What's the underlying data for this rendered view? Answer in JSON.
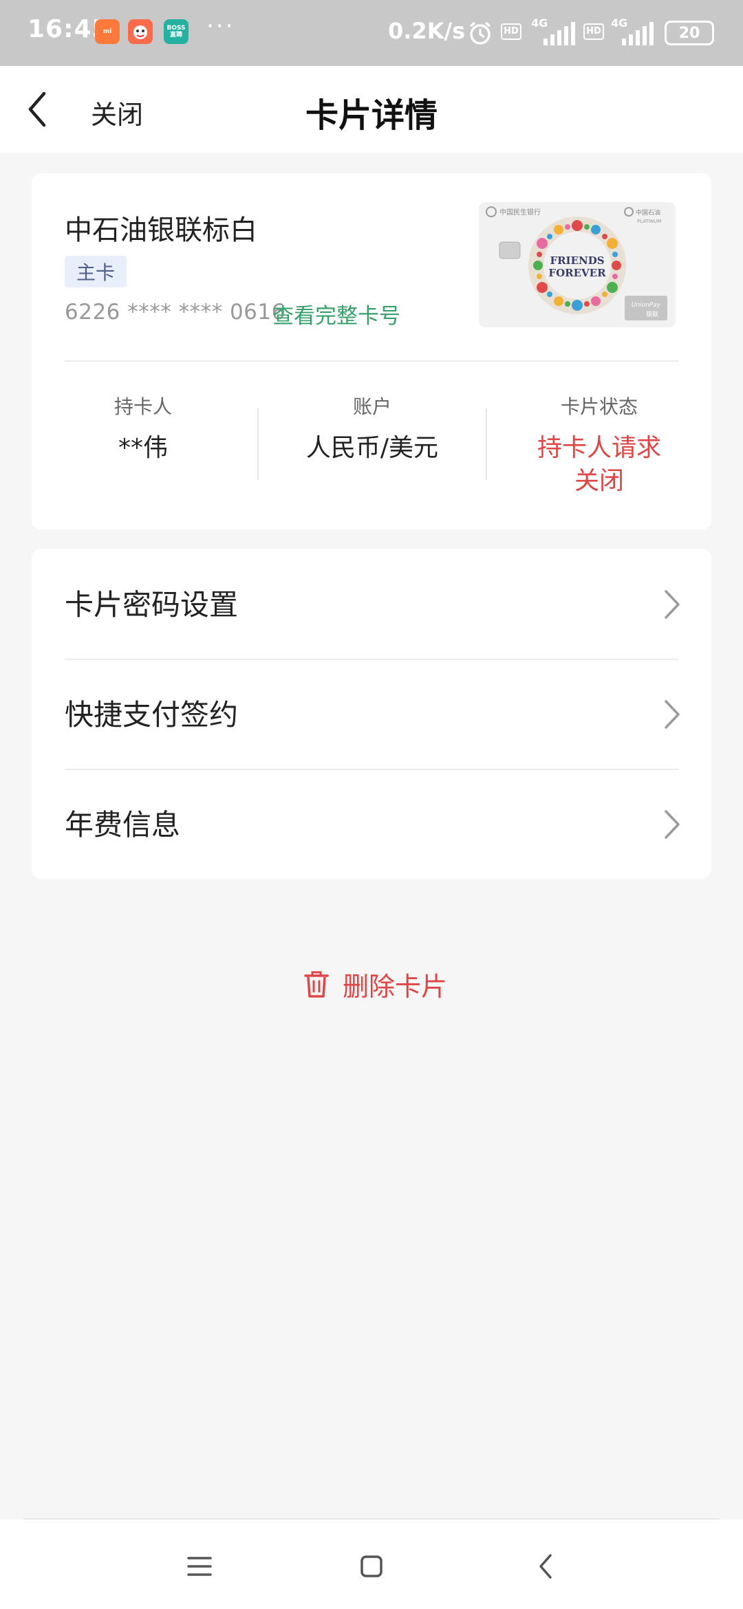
{
  "status_bar": {
    "time": "16:45",
    "app_icons": [
      {
        "name": "mi-store-icon",
        "label": "mi",
        "color": "#ff7a3a"
      },
      {
        "name": "game-app-icon",
        "label": "",
        "color": "#ff6a4a"
      },
      {
        "name": "boss-zhipin-icon",
        "label": "BOSS 直聘",
        "color": "#25b1a2"
      }
    ],
    "more": "···",
    "net_speed": "0.2K/s",
    "network_a": "4G",
    "network_b": "4G",
    "battery": "20"
  },
  "header": {
    "close_label": "关闭",
    "title": "卡片详情"
  },
  "card": {
    "name": "中石油银联标白",
    "tag": "主卡",
    "number": "6226 **** **** 0616",
    "view_full_label": "查看完整卡号",
    "image": {
      "bank_text": "中国民生银行",
      "partner_text": "中国石油",
      "tier_text": "PLATINUM",
      "motto_line1": "FRIENDS",
      "motto_line2": "FOREVER",
      "network_text": "UnionPay",
      "network_cn": "银联"
    },
    "info": [
      {
        "label": "持卡人",
        "value": "**伟"
      },
      {
        "label": "账户",
        "value": "人民币/美元"
      },
      {
        "label": "卡片状态",
        "value_line1": "持卡人请求",
        "value_line2": "关闭"
      }
    ]
  },
  "menu": [
    {
      "label": "卡片密码设置"
    },
    {
      "label": "快捷支付签约"
    },
    {
      "label": "年费信息"
    }
  ],
  "delete_label": "删除卡片",
  "colors": {
    "accent_green": "#35a06a",
    "danger_red": "#e04545",
    "tag_bg": "#e8eefa"
  }
}
